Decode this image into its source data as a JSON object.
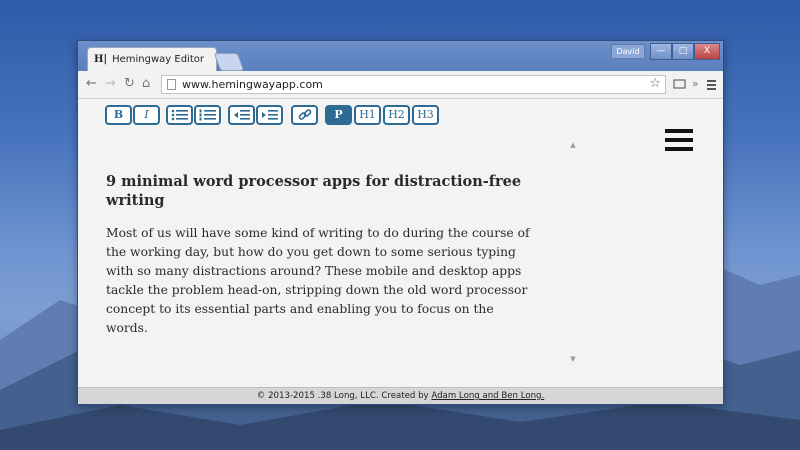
{
  "window": {
    "tab_title": "Hemingway Editor",
    "tab_favicon": "H|",
    "user_name": "David",
    "minimize_glyph": "—",
    "maximize_glyph": "□",
    "close_glyph": "X"
  },
  "toolbar": {
    "url": "www.hemingwayapp.com",
    "extension_glyph": "»"
  },
  "editor": {
    "buttons": {
      "bold": "B",
      "italic": "I",
      "p": "P",
      "h1": "H1",
      "h2": "H2",
      "h3": "H3"
    },
    "active_button": "P"
  },
  "article": {
    "title": "9 minimal word processor apps for distraction-free writing",
    "body": "Most of us will have some kind of writing to do during the course of the working day, but how do you get down to some serious typing with so many distractions around? These mobile and desktop apps tackle the problem head-on, stripping down the old word processor concept to its essential parts and enabling you to focus on the words."
  },
  "footer": {
    "prefix": "© 2013-2015 .38 Long, LLC. Created by ",
    "link": "Adam Long and Ben Long."
  },
  "colors": {
    "accent": "#2e6b94",
    "desktop_sky": "#4773bd",
    "window_frame": "#5a7fbe"
  }
}
